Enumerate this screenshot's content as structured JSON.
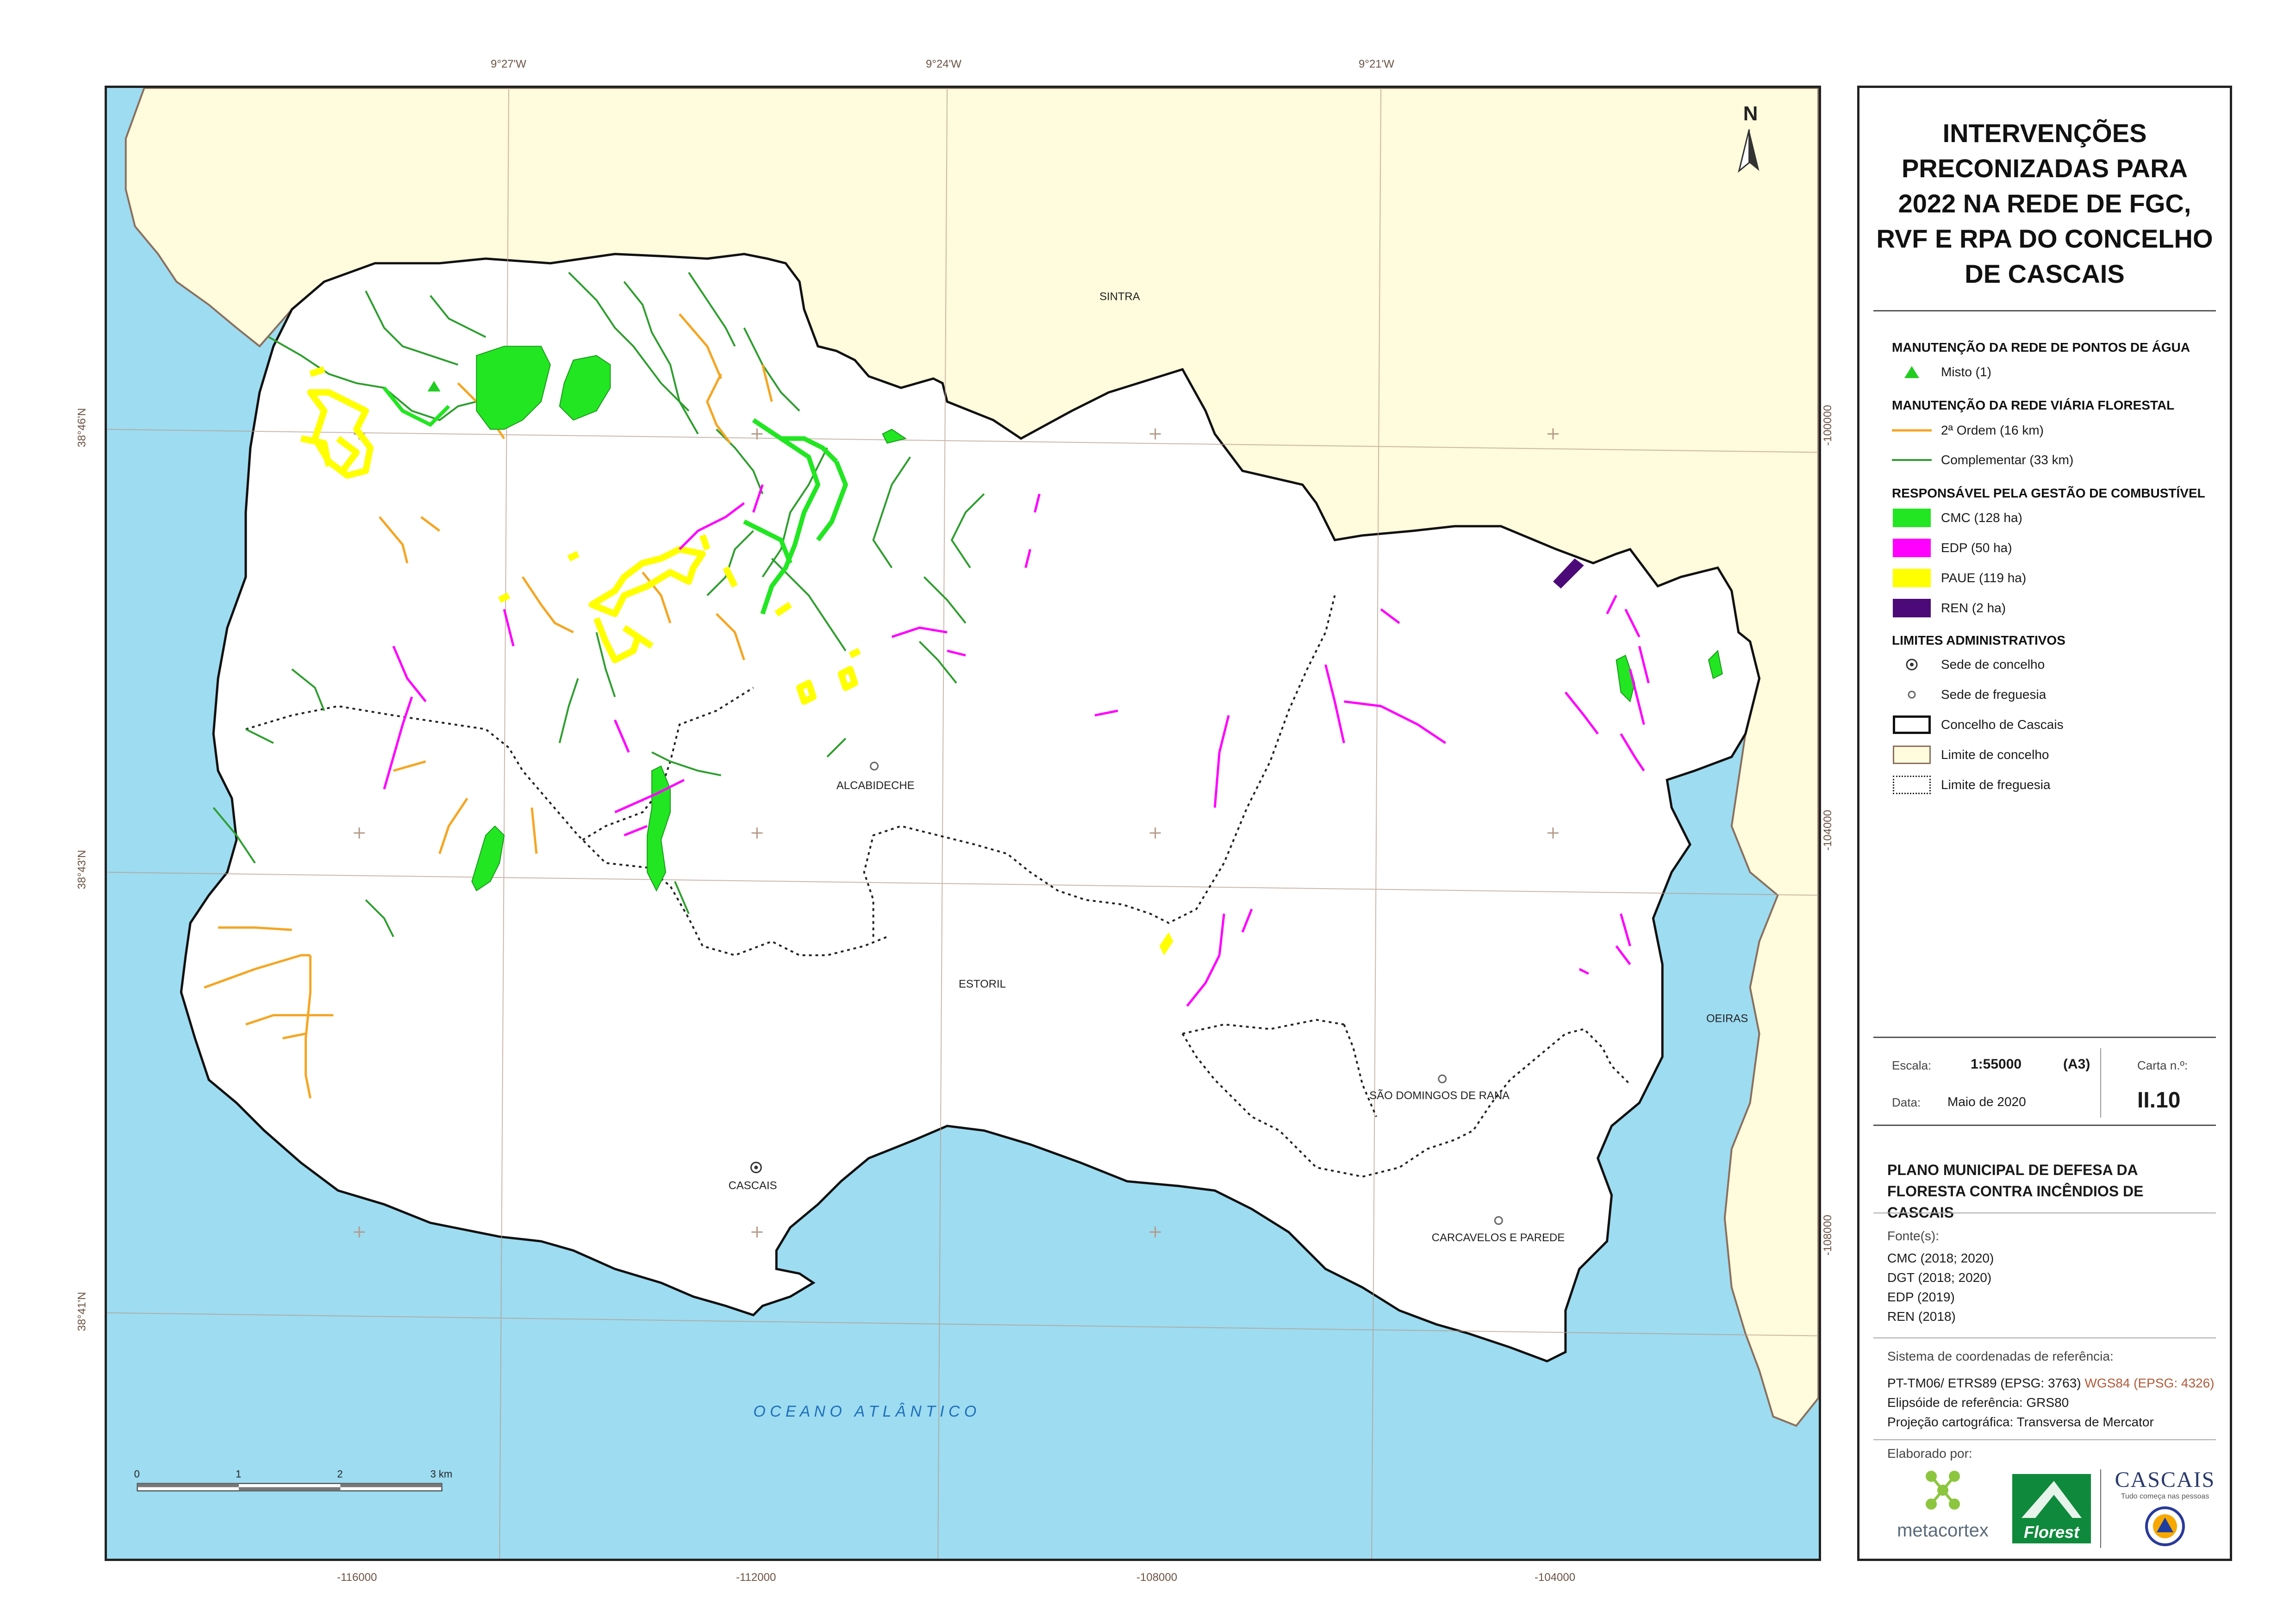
{
  "map": {
    "longitude_ticks": [
      "9°27'W",
      "9°24'W",
      "9°21'W"
    ],
    "latitude_ticks": [
      "38°46'N",
      "38°43'N",
      "38°41'N"
    ],
    "easting_ticks": [
      "-116000",
      "-112000",
      "-108000",
      "-104000"
    ],
    "northing_ticks": [
      "-100000",
      "-104000",
      "-108000"
    ],
    "place_labels": {
      "sintra": "SINTRA",
      "oeiras": "OEIRAS",
      "alcabideche": "ALCABIDECHE",
      "estoril": "ESTORIL",
      "sao_domingos": "SÃO DOMINGOS DE RANA",
      "cascais": "CASCAIS",
      "carcavelos": "CARCAVELOS E PAREDE",
      "ocean": "O C E A N O   A T L Â N T I C O"
    },
    "north_label": "N",
    "scale_bar": {
      "labels": [
        "0",
        "1",
        "2",
        "3 km"
      ]
    },
    "colors": {
      "sea": "#9ddcf1",
      "neighbour_land": "#fffbdc",
      "municipality": "#ffffff",
      "cmc": "#22e622",
      "edp": "#ff00ff",
      "paue": "#ffff00",
      "ren": "#4b0a78",
      "road_2nd_order": "#f5a623",
      "road_complementary": "#2e9e2e",
      "grid": "#b59a8a"
    }
  },
  "panel": {
    "title": "INTERVENÇÕES PRECONIZADAS PARA 2022 NA REDE DE FGC, RVF E RPA DO CONCELHO DE CASCAIS",
    "legend": {
      "water_points_heading": "MANUTENÇÃO DA REDE DE PONTOS DE ÁGUA",
      "water_points_item": "Misto (1)",
      "roads_heading": "MANUTENÇÃO DA REDE VIÁRIA FLORESTAL",
      "roads_items": [
        "2ª Ordem (16 km)",
        "Complementar (33 km)"
      ],
      "fuel_heading": "RESPONSÁVEL PELA GESTÃO DE COMBUSTÍVEL",
      "fuel_items": [
        "CMC (128 ha)",
        "EDP (50 ha)",
        "PAUE (119 ha)",
        "REN (2 ha)"
      ],
      "admin_heading": "LIMITES ADMINISTRATIVOS",
      "admin_items": [
        "Sede de concelho",
        "Sede de freguesia",
        "Concelho de Cascais",
        "Limite de concelho",
        "Limite de freguesia"
      ]
    },
    "info": {
      "scale_label": "Escala:",
      "scale_value": "1:55000",
      "paper": "(A3)",
      "sheet_label": "Carta n.º:",
      "sheet_value": "II.10",
      "date_label": "Data:",
      "date_value": "Maio de 2020"
    },
    "plan_title": "PLANO MUNICIPAL DE DEFESA DA FLORESTA CONTRA INCÊNDIOS DE CASCAIS",
    "sources_label": "Fonte(s):",
    "sources": [
      "CMC (2018; 2020)",
      "DGT (2018; 2020)",
      "EDP (2019)",
      "REN (2018)"
    ],
    "crs_label": "Sistema de coordenadas de referência:",
    "crs_primary": "PT-TM06/ ETRS89 (EPSG: 3763)",
    "crs_secondary": "WGS84 (EPSG: 4326)",
    "ellipsoid": "Elipsóide de referência: GRS80",
    "projection": "Projeção cartográfica: Transversa de Mercator",
    "made_by": "Elaborado por:",
    "logos": {
      "metacortex": "metacortex",
      "florest": "Florest",
      "cascais": "CASCAIS",
      "cascais_tagline": "Tudo começa nas pessoas"
    }
  }
}
